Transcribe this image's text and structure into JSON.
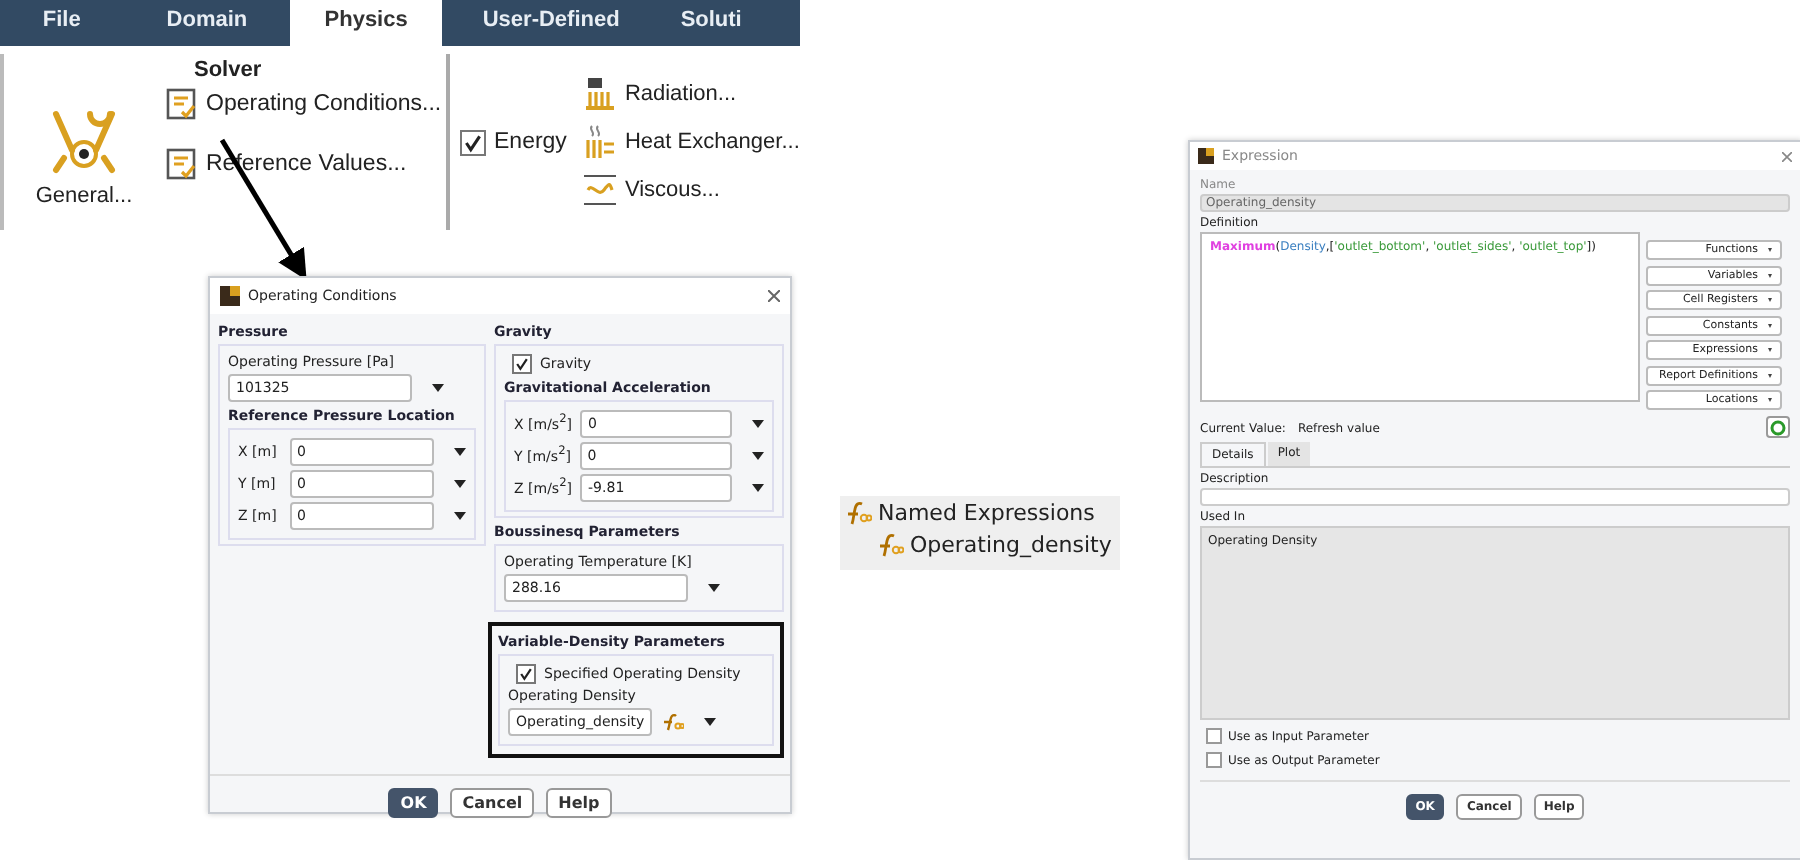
{
  "ribbon": {
    "tabs": [
      {
        "label": "File",
        "selected": false
      },
      {
        "label": "Domain",
        "selected": false
      },
      {
        "label": "Physics",
        "selected": true
      },
      {
        "label": "User-Defined",
        "selected": false
      },
      {
        "label": "Soluti",
        "selected": false
      }
    ],
    "solver": {
      "title": "Solver",
      "general": "General...",
      "commands": [
        "Operating Conditions...",
        "Reference Values..."
      ]
    },
    "energy": {
      "label": "Energy",
      "checked": true
    },
    "models": [
      "Radiation...",
      "Heat Exchanger...",
      "Viscous..."
    ]
  },
  "operating_conditions": {
    "title": "Operating Conditions",
    "pressure": {
      "title": "Pressure",
      "operating_pressure": {
        "label": "Operating Pressure [Pa]",
        "value": "101325"
      },
      "location_title": "Reference Pressure Location",
      "fields": [
        {
          "label": "X [m]",
          "value": "0"
        },
        {
          "label": "Y [m]",
          "value": "0"
        },
        {
          "label": "Z [m]",
          "value": "0"
        }
      ]
    },
    "gravity": {
      "title": "Gravity",
      "checkbox": {
        "label": "Gravity",
        "checked": true
      },
      "acceleration_title": "Gravitational Acceleration",
      "fields": [
        {
          "label": "X [m/s$^{2}$]",
          "value": "0"
        },
        {
          "label": "Y [m/s$^{2}$]",
          "value": "0"
        },
        {
          "label": "Z [m/s$^{2}$]",
          "value": "-9.81"
        }
      ]
    },
    "boussinesq": {
      "title": "Boussinesq Parameters",
      "label": "Operating Temperature [K]",
      "value": "288.16"
    },
    "variable_density": {
      "title": "Variable-Density Parameters",
      "checkbox": {
        "label": "Specified Operating Density",
        "checked": true
      },
      "label": "Operating Density",
      "value": "Operating_density"
    },
    "buttons": [
      {
        "label": "OK",
        "kind": "primary"
      },
      {
        "label": "Cancel",
        "kind": "normal"
      },
      {
        "label": "Help",
        "kind": "normal"
      }
    ]
  },
  "tree": [
    {
      "label": "Named Expressions",
      "children": [
        {
          "label": "Operating_density"
        }
      ]
    }
  ],
  "expression": {
    "title": "Expression",
    "name": {
      "label": "Name",
      "value": "Operating_density"
    },
    "definition": {
      "label": "Definition",
      "tokens": [
        {
          "text": "Maximum",
          "kind": "function"
        },
        {
          "text": "(",
          "kind": "punct"
        },
        {
          "text": "Density",
          "kind": "variable"
        },
        {
          "text": ",[",
          "kind": "punct"
        },
        {
          "text": "'outlet_bottom'",
          "kind": "string"
        },
        {
          "text": ", ",
          "kind": "punct"
        },
        {
          "text": "'outlet_sides'",
          "kind": "string"
        },
        {
          "text": ", ",
          "kind": "punct"
        },
        {
          "text": "'outlet_top'",
          "kind": "string"
        },
        {
          "text": "])",
          "kind": "punct"
        }
      ]
    },
    "menus": [
      "Functions",
      "Variables",
      "Cell Registers",
      "Constants",
      "Expressions",
      "Report Definitions",
      "Locations"
    ],
    "current_value": {
      "label": "Current Value:",
      "link": "Refresh value"
    },
    "tabs": [
      {
        "label": "Details",
        "selected": true
      },
      {
        "label": "Plot",
        "selected": false
      }
    ],
    "description": {
      "label": "Description"
    },
    "used_in": {
      "label": "Used In",
      "items": [
        "Operating Density"
      ]
    },
    "checkboxes": [
      {
        "label": "Use as Input Parameter",
        "checked": false
      },
      {
        "label": "Use as Output Parameter",
        "checked": false
      }
    ],
    "buttons": [
      {
        "label": "OK",
        "kind": "primary"
      },
      {
        "label": "Cancel",
        "kind": "normal"
      },
      {
        "label": "Help",
        "kind": "normal"
      }
    ]
  }
}
